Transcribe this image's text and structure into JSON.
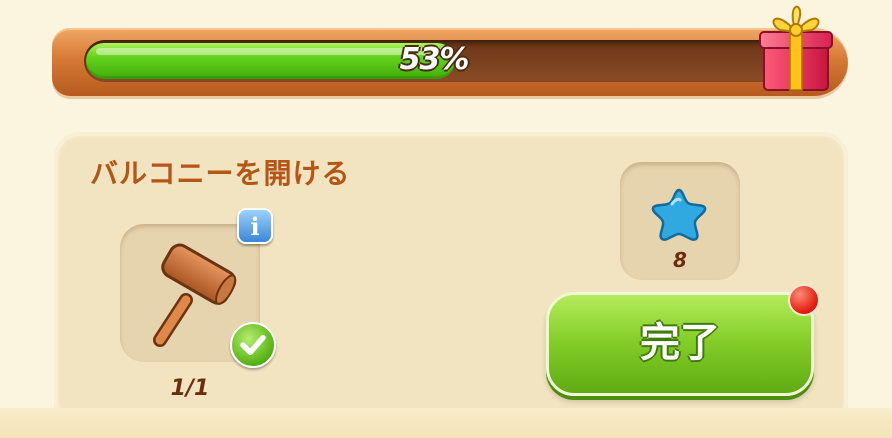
{
  "progress": {
    "percent": 53,
    "label": "53%",
    "reward_icon": "gift-box-icon"
  },
  "task": {
    "title": "バルコニーを開ける",
    "item": {
      "icon": "wooden-mallet-icon",
      "info_label": "i",
      "count": "1/1",
      "completed": true
    },
    "reward": {
      "icon": "blue-star-icon",
      "amount": "8"
    },
    "complete_button": "完了"
  },
  "colors": {
    "progress_fill": "#5cc918",
    "title": "#b55516",
    "button": "#86cf2a",
    "notification": "#e3200f"
  }
}
